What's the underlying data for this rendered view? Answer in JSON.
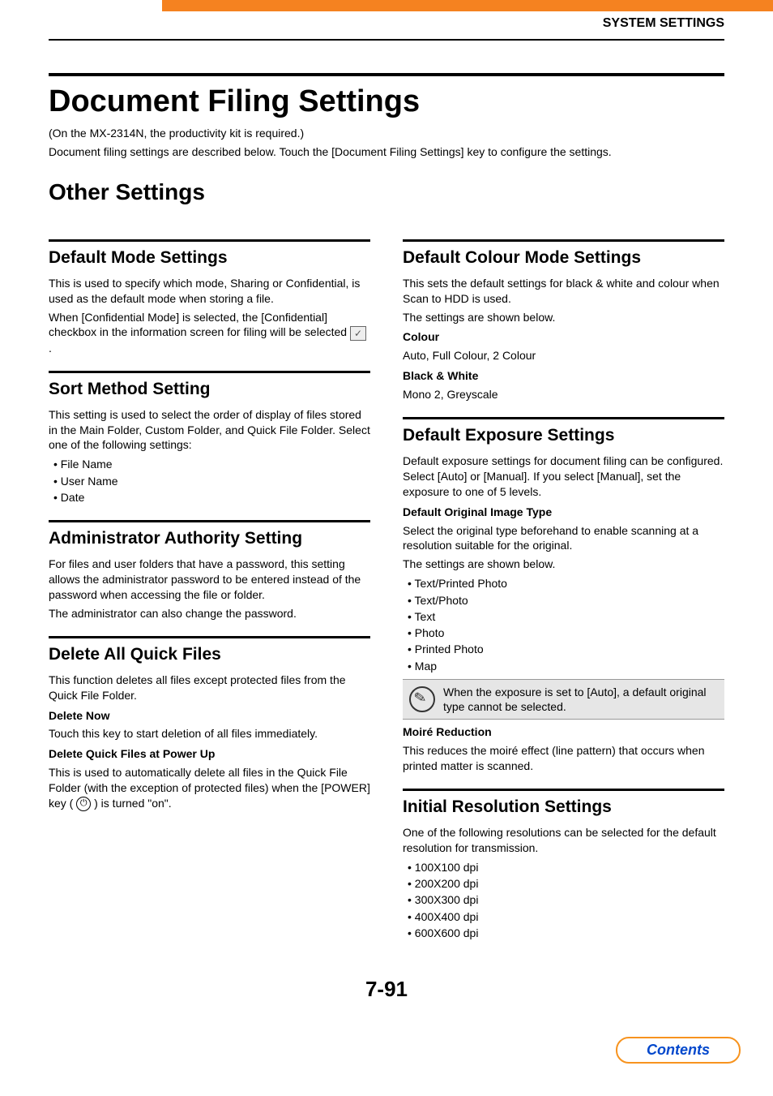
{
  "chapter": "SYSTEM SETTINGS",
  "h1": "Document Filing Settings",
  "intro1": "(On the MX-2314N, the productivity kit is required.)",
  "intro2": "Document filing settings are described below. Touch the [Document Filing Settings] key to configure the settings.",
  "h2": "Other Settings",
  "left": {
    "defaultMode": {
      "title": "Default Mode Settings",
      "p1": "This is used to specify which mode, Sharing or Confidential, is used as the default mode when storing a file.",
      "p2a": "When [Confidential Mode] is selected, the [Confidential] checkbox in the information screen for filing will be selected ",
      "p2b": " ."
    },
    "sortMethod": {
      "title": "Sort Method Setting",
      "p1": "This setting is used to select the order of display of files stored in the Main Folder, Custom Folder, and Quick File Folder. Select one of the following settings:",
      "items": [
        "File Name",
        "User Name",
        "Date"
      ]
    },
    "adminAuth": {
      "title": "Administrator Authority Setting",
      "p1": "For files and user folders that have a password, this setting allows the administrator password to be entered instead of the password when accessing the file or folder.",
      "p2": "The administrator can also change the password."
    },
    "deleteAll": {
      "title": "Delete All Quick Files",
      "p1": "This function deletes all files except protected files from the Quick File Folder.",
      "sub1": "Delete Now",
      "sub1p": "Touch this key to start deletion of all files immediately.",
      "sub2": "Delete Quick Files at Power Up",
      "sub2pA": "This is used to automatically delete all files in the Quick File Folder (with the exception of protected files) when the [POWER] key (",
      "sub2pB": ") is turned \"on\"."
    }
  },
  "right": {
    "defaultColour": {
      "title": "Default Colour Mode Settings",
      "p1": "This sets the default settings for black & white and colour when Scan to HDD is used.",
      "p2": "The settings are shown below.",
      "colourLabel": "Colour",
      "colourVal": "Auto, Full Colour, 2 Colour",
      "bwLabel": "Black & White",
      "bwVal": "Mono 2, Greyscale"
    },
    "defaultExposure": {
      "title": "Default Exposure Settings",
      "p1": "Default exposure settings for document filing can be configured. Select [Auto] or [Manual]. If you select [Manual], set the exposure to one of 5 levels.",
      "sub1": "Default Original Image Type",
      "sub1p": "Select the original type beforehand to enable scanning at a resolution suitable for the original.",
      "sub1p2": "The settings are shown below.",
      "items": [
        "Text/Printed Photo",
        "Text/Photo",
        "Text",
        "Photo",
        "Printed Photo",
        "Map"
      ],
      "note": "When the exposure is set to [Auto], a default original type cannot be selected.",
      "sub2": "Moiré Reduction",
      "sub2p": "This reduces the moiré effect (line pattern) that occurs when printed matter is scanned."
    },
    "initialRes": {
      "title": "Initial Resolution Settings",
      "p1": "One of the following resolutions can be selected for the default resolution for transmission.",
      "items": [
        "100X100 dpi",
        "200X200 dpi",
        "300X300 dpi",
        "400X400 dpi",
        "600X600 dpi"
      ]
    }
  },
  "pageNum": "7-91",
  "contentsLabel": "Contents"
}
